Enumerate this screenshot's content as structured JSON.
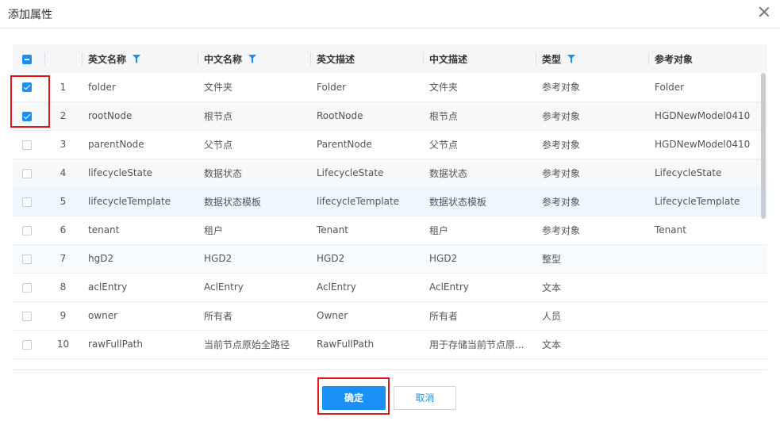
{
  "dialog": {
    "title": "添加属性"
  },
  "table": {
    "columns": [
      {
        "label": "",
        "filter": false
      },
      {
        "label": "",
        "filter": false
      },
      {
        "label": "英文名称",
        "filter": true
      },
      {
        "label": "中文名称",
        "filter": true
      },
      {
        "label": "英文描述",
        "filter": false
      },
      {
        "label": "中文描述",
        "filter": false
      },
      {
        "label": "类型",
        "filter": true
      },
      {
        "label": "参考对象",
        "filter": false
      }
    ],
    "header_checkbox": "indeterminate",
    "rows": [
      {
        "checked": true,
        "index": "1",
        "name_en": "folder",
        "name_cn": "文件夹",
        "desc_en": "Folder",
        "desc_cn": "文件夹",
        "type": "参考对象",
        "ref": "Folder"
      },
      {
        "checked": true,
        "index": "2",
        "name_en": "rootNode",
        "name_cn": "根节点",
        "desc_en": "RootNode",
        "desc_cn": "根节点",
        "type": "参考对象",
        "ref": "HGDNewModel0410"
      },
      {
        "checked": false,
        "index": "3",
        "name_en": "parentNode",
        "name_cn": "父节点",
        "desc_en": "ParentNode",
        "desc_cn": "父节点",
        "type": "参考对象",
        "ref": "HGDNewModel0410"
      },
      {
        "checked": false,
        "index": "4",
        "name_en": "lifecycleState",
        "name_cn": "数据状态",
        "desc_en": "LifecycleState",
        "desc_cn": "数据状态",
        "type": "参考对象",
        "ref": "LifecycleState"
      },
      {
        "checked": false,
        "index": "5",
        "name_en": "lifecycleTemplate",
        "name_cn": "数据状态模板",
        "desc_en": "lifecycleTemplate",
        "desc_cn": "数据状态模板",
        "type": "参考对象",
        "ref": "LifecycleTemplate"
      },
      {
        "checked": false,
        "index": "6",
        "name_en": "tenant",
        "name_cn": "租户",
        "desc_en": "Tenant",
        "desc_cn": "租户",
        "type": "参考对象",
        "ref": "Tenant"
      },
      {
        "checked": false,
        "index": "7",
        "name_en": "hgD2",
        "name_cn": "HGD2",
        "desc_en": "HGD2",
        "desc_cn": "HGD2",
        "type": "整型",
        "ref": ""
      },
      {
        "checked": false,
        "index": "8",
        "name_en": "aclEntry",
        "name_cn": "AclEntry",
        "desc_en": "AclEntry",
        "desc_cn": "AclEntry",
        "type": "文本",
        "ref": ""
      },
      {
        "checked": false,
        "index": "9",
        "name_en": "owner",
        "name_cn": "所有者",
        "desc_en": "Owner",
        "desc_cn": "所有者",
        "type": "人员",
        "ref": ""
      },
      {
        "checked": false,
        "index": "10",
        "name_en": "rawFullPath",
        "name_cn": "当前节点原始全路径",
        "desc_en": "RawFullPath",
        "desc_cn": "用于存储当前节点原...",
        "type": "文本",
        "ref": ""
      }
    ]
  },
  "footer": {
    "confirm_label": "确定",
    "cancel_label": "取消"
  },
  "colors": {
    "accent": "#1a8ff5",
    "highlight": "#e0161b",
    "header_bg": "#f4f6f8"
  },
  "icons": {
    "filter": "filter-icon",
    "close": "close-icon"
  }
}
